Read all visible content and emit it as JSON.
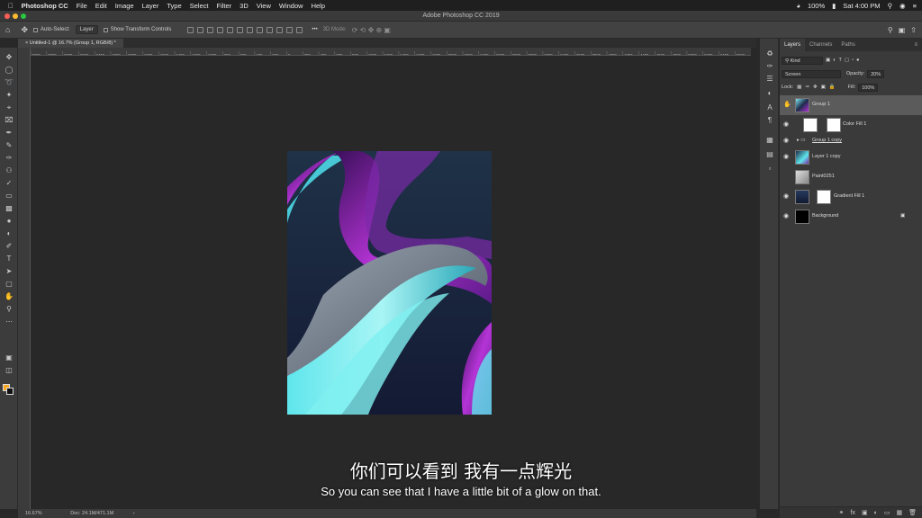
{
  "menubar": {
    "app": "Photoshop CC",
    "items": [
      "File",
      "Edit",
      "Image",
      "Layer",
      "Type",
      "Select",
      "Filter",
      "3D",
      "View",
      "Window",
      "Help"
    ],
    "battery": "100%",
    "clock": "Sat 4:00 PM"
  },
  "window": {
    "title": "Adobe Photoshop CC 2019"
  },
  "options": {
    "auto_select_label": "Auto-Select:",
    "auto_select_value": "Layer",
    "transform_label": "Show Transform Controls",
    "mode_label": "3D Mode:"
  },
  "document": {
    "tab_title": "Untitled-1 @ 16.7% (Group 1, RGB/8) *"
  },
  "ruler": {
    "ticks": [
      "3200",
      "3000",
      "2800",
      "2600",
      "2400",
      "2200",
      "2000",
      "1800",
      "1600",
      "1400",
      "1200",
      "1000",
      "800",
      "600",
      "400",
      "200",
      "0",
      "200",
      "400",
      "600",
      "800",
      "1000",
      "1200",
      "1400",
      "1600",
      "1800",
      "2000",
      "2200",
      "2400",
      "2600",
      "2800",
      "3000",
      "3200",
      "3400",
      "3600",
      "3800",
      "4000",
      "4200",
      "4400",
      "4600",
      "4800",
      "5000",
      "5200",
      "5400",
      "5600"
    ]
  },
  "status": {
    "zoom": "16.67%",
    "doc": "Doc: 24.1M/471.1M"
  },
  "subtitles": {
    "chinese": "你们可以看到 我有一点辉光",
    "english": "So you can see that I have a little bit of a glow on that."
  },
  "panel": {
    "tabs": [
      "Layers",
      "Channels",
      "Paths"
    ],
    "filter_kind": "Kind",
    "blend_mode": "Screen",
    "opacity_label": "Opacity:",
    "opacity_value": "20%",
    "lock_label": "Lock:",
    "fill_label": "Fill:",
    "fill_value": "100%",
    "layers": [
      {
        "name": "Group 1",
        "visible": true,
        "selected": true
      },
      {
        "name": "Color Fill 1",
        "visible": true,
        "selected": false
      },
      {
        "name": "Group 1 copy",
        "visible": true,
        "selected": false
      },
      {
        "name": "Layer 1 copy",
        "visible": true,
        "selected": false
      },
      {
        "name": "Paint0251",
        "visible": false,
        "selected": false
      },
      {
        "name": "Gradient Fill 1",
        "visible": true,
        "selected": false
      },
      {
        "name": "Background",
        "visible": true,
        "selected": false
      }
    ]
  },
  "colors": {
    "foreground": "#f5a623",
    "background": "#111111",
    "accent_selection": "#5b5b5b"
  }
}
